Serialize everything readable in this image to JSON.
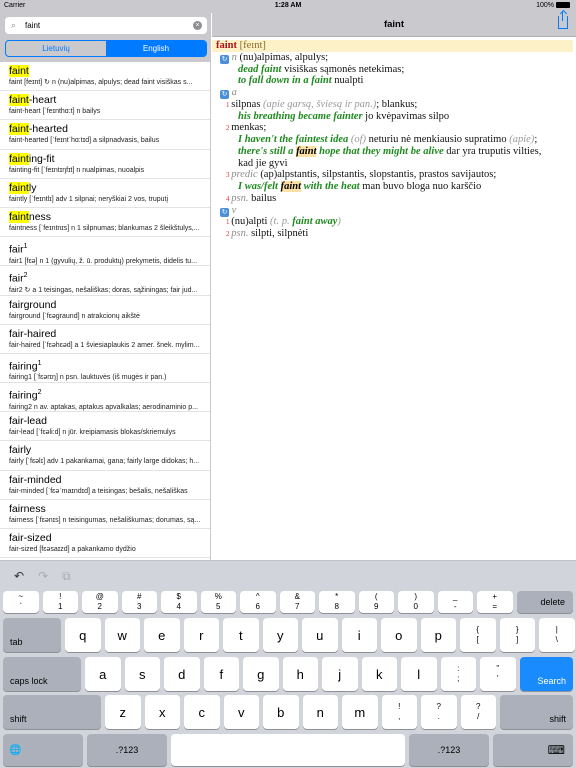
{
  "status": {
    "carrier": "Carrier",
    "time": "1:28 AM",
    "battery": "100%"
  },
  "search": {
    "value": "faint",
    "placeholder": ""
  },
  "segments": [
    "Lietuvių",
    "English"
  ],
  "nav": {
    "title": "faint"
  },
  "list": [
    {
      "hl": "faint",
      "rest": "",
      "sup": "",
      "def": "faint [feɪnt] ↻ n (nu)alpimas, alpulys; dead faint visiškas s..."
    },
    {
      "hl": "faint",
      "rest": "-heart",
      "sup": "",
      "def": "faint-heart [ˈfeɪnthɑ:t] n bailys"
    },
    {
      "hl": "faint",
      "rest": "-hearted",
      "sup": "",
      "def": "faint-hearted [ˈfeɪntˈhɑ:tɪd] a silpnadvasis, bailus"
    },
    {
      "hl": "faint",
      "rest": "ing-fit",
      "sup": "",
      "def": "fainting-fit [ˈfeɪntɪŋfɪt] n nualpimas, nuoalpis"
    },
    {
      "hl": "faint",
      "rest": "ly",
      "sup": "",
      "def": "faintly [ˈfeɪntlɪ] adv 1 silpnai; neryškiai 2 vos, truputį"
    },
    {
      "hl": "faint",
      "rest": "ness",
      "sup": "",
      "def": "faintness [ˈfeɪntnɪs] n 1 silpnumas; blankumas 2 šleikštulys,..."
    },
    {
      "hl": "",
      "rest": "fair",
      "sup": "1",
      "def": "fair1 [fɛə] n 1 (gyvulių, ž. ū. produktų) prekymetis, didelis tu..."
    },
    {
      "hl": "",
      "rest": "fair",
      "sup": "2",
      "def": "fair2 ↻ a 1 teisingas, nešališkas; doras, sąžiningas; fair jud..."
    },
    {
      "hl": "",
      "rest": "fairground",
      "sup": "",
      "def": "fairground [ˈfɛəgraund] n atrakcionų aikštė"
    },
    {
      "hl": "",
      "rest": "fair-haired",
      "sup": "",
      "def": "fair-haired [ˈfɛəhɛəd] a 1 šviesiaplaukis 2 amer. šnek. mylim..."
    },
    {
      "hl": "",
      "rest": "fairing",
      "sup": "1",
      "def": "fairing1 [ˈfɛərɪŋ] n psn. lauktuvės (iš mugės ir pan.)"
    },
    {
      "hl": "",
      "rest": "fairing",
      "sup": "2",
      "def": "fairing2 n av. aptakas, aptakus apvalkalas; aerodinaminio p..."
    },
    {
      "hl": "",
      "rest": "fair-lead",
      "sup": "",
      "def": "fair-lead [ˈfɛəli:d] n jūr. kreipiamasis blokas/skriemulys"
    },
    {
      "hl": "",
      "rest": "fairly",
      "sup": "",
      "def": "fairly [ˈfɛəlɪ] adv 1 pakankamai, gana; fairly large didokas; h..."
    },
    {
      "hl": "",
      "rest": "fair-minded",
      "sup": "",
      "def": "fair-minded [ˈfɛəˈmaɪndɪd] a teisingas; bešalis, nešališkas"
    },
    {
      "hl": "",
      "rest": "fairness",
      "sup": "",
      "def": "fairness [ˈfɛənɪs] n teisingumas, nešališkumas; dorumas, są..."
    },
    {
      "hl": "",
      "rest": "fair-sized",
      "sup": "",
      "def": "fair-sized [fɛəsaɪzd] a pakankamo dydžio"
    }
  ],
  "entry": [
    {
      "indent": 0,
      "head": true,
      "seg": [
        [
          "hw",
          "faint"
        ],
        [
          "txt",
          " "
        ],
        [
          "tr",
          "[feɪnt]"
        ]
      ]
    },
    {
      "indent": 8,
      "seg": [
        [
          "ico",
          "↻"
        ],
        [
          "txt",
          " "
        ],
        [
          "pos",
          "n"
        ],
        [
          "txt",
          " (nu)alpimas, alpulys;"
        ]
      ]
    },
    {
      "indent": 26,
      "seg": [
        [
          "ex",
          "dead faint"
        ],
        [
          "txt",
          " visiškas sąmonės netekimas;"
        ]
      ]
    },
    {
      "indent": 26,
      "seg": [
        [
          "ex",
          "to fall down in a faint"
        ],
        [
          "txt",
          " nualpti"
        ]
      ]
    },
    {
      "indent": 8,
      "seg": [
        [
          "ico",
          "↻"
        ],
        [
          "txt",
          " "
        ],
        [
          "pos",
          "a"
        ]
      ]
    },
    {
      "indent": 14,
      "seg": [
        [
          "num",
          "1 "
        ],
        [
          "txt",
          "silpnas "
        ],
        [
          "note",
          "(apie garsą, šviesą ir pan.)"
        ],
        [
          "txt",
          "; blankus;"
        ]
      ]
    },
    {
      "indent": 26,
      "seg": [
        [
          "ex",
          "his breathing became fainter"
        ],
        [
          "txt",
          " jo kvėpavimas silpo"
        ]
      ]
    },
    {
      "indent": 14,
      "seg": [
        [
          "num",
          "2 "
        ],
        [
          "txt",
          "menkas;"
        ]
      ]
    },
    {
      "indent": 26,
      "seg": [
        [
          "ex",
          "I haven't the faintest idea"
        ],
        [
          "txt",
          " "
        ],
        [
          "note",
          "(of)"
        ],
        [
          "txt",
          " neturiu nė menkiausio supratimo "
        ],
        [
          "note",
          "(apie)"
        ],
        [
          "txt",
          ";"
        ]
      ]
    },
    {
      "indent": 26,
      "seg": [
        [
          "ex",
          "there's still a "
        ],
        [
          "exhl",
          "faint"
        ],
        [
          "ex",
          " hope that they might be alive"
        ],
        [
          "txt",
          " dar yra truputis vilties,"
        ]
      ]
    },
    {
      "indent": 26,
      "seg": [
        [
          "txt",
          "kad jie gyvi"
        ]
      ]
    },
    {
      "indent": 14,
      "seg": [
        [
          "num",
          "3 "
        ],
        [
          "pos",
          "predic"
        ],
        [
          "txt",
          " (ap)alpstantis, silpstantis, slopstantis, prastos savijautos;"
        ]
      ]
    },
    {
      "indent": 26,
      "seg": [
        [
          "ex",
          "I was/felt "
        ],
        [
          "exhl",
          "faint"
        ],
        [
          "ex",
          " with the heat"
        ],
        [
          "txt",
          " man buvo bloga nuo karščio"
        ]
      ]
    },
    {
      "indent": 14,
      "seg": [
        [
          "num",
          "4 "
        ],
        [
          "pos",
          "psn."
        ],
        [
          "txt",
          " bailus"
        ]
      ]
    },
    {
      "indent": 8,
      "seg": [
        [
          "ico",
          "↻"
        ],
        [
          "txt",
          " "
        ],
        [
          "pos",
          "v"
        ]
      ]
    },
    {
      "indent": 14,
      "seg": [
        [
          "num",
          "1 "
        ],
        [
          "txt",
          "(nu)alpti "
        ],
        [
          "note",
          "(t. p. "
        ],
        [
          "ex",
          "faint away"
        ],
        [
          "note",
          ")"
        ]
      ]
    },
    {
      "indent": 14,
      "seg": [
        [
          "num",
          "2 "
        ],
        [
          "pos",
          "psn."
        ],
        [
          "txt",
          " silpti, silpnėti"
        ]
      ]
    }
  ],
  "keyboard": {
    "tools": [
      "↶",
      "↷",
      "⧉"
    ],
    "numrow": [
      [
        "~",
        "`"
      ],
      [
        "!",
        "1"
      ],
      [
        "@",
        "2"
      ],
      [
        "#",
        "3"
      ],
      [
        "$",
        "4"
      ],
      [
        "%",
        "5"
      ],
      [
        "^",
        "6"
      ],
      [
        "&",
        "7"
      ],
      [
        "*",
        "8"
      ],
      [
        "(",
        "9"
      ],
      [
        ")",
        "0"
      ],
      [
        "_",
        "-"
      ],
      [
        "+",
        "="
      ]
    ],
    "delete": "delete",
    "tab": "tab",
    "caps": "caps lock",
    "shift": "shift",
    "search": "Search",
    "num": ".?123",
    "globe": "🌐",
    "hide": "⌨",
    "row1": [
      "q",
      "w",
      "e",
      "r",
      "t",
      "y",
      "u",
      "i",
      "o",
      "p"
    ],
    "row1p": [
      [
        "{",
        "["
      ],
      [
        "}",
        "]"
      ],
      [
        "|",
        "\\"
      ]
    ],
    "row2": [
      "a",
      "s",
      "d",
      "f",
      "g",
      "h",
      "j",
      "k",
      "l"
    ],
    "row2p": [
      [
        ":",
        ";"
      ],
      [
        "\"",
        "'"
      ]
    ],
    "row3": [
      "z",
      "x",
      "c",
      "v",
      "b",
      "n",
      "m"
    ],
    "row3p": [
      [
        "!",
        ","
      ],
      [
        "?",
        "."
      ],
      [
        "?",
        "/"
      ]
    ]
  },
  "colors": {
    "accent": "#007aff",
    "highlight": "#ffff00",
    "headword": "#b0121b",
    "example": "#1e8a1e"
  }
}
